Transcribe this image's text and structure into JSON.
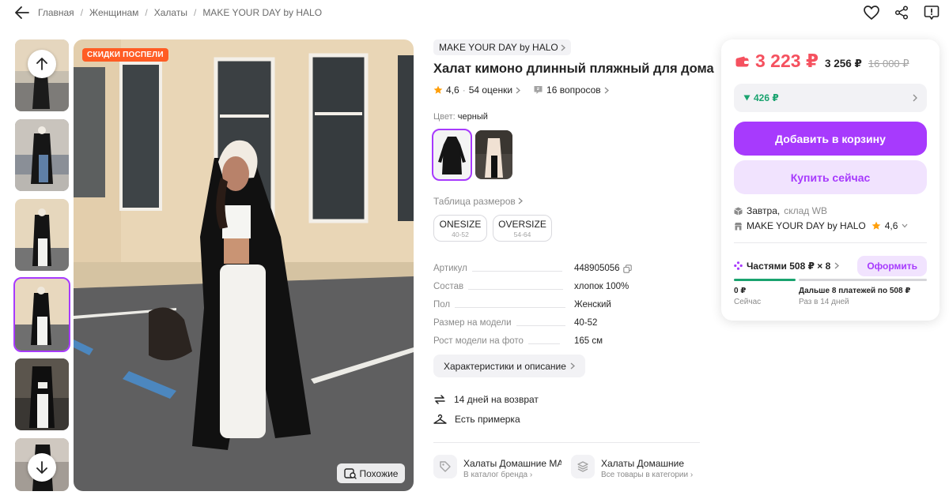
{
  "header": {
    "breadcrumbs": [
      "Главная",
      "Женщинам",
      "Халаты",
      "MAKE YOUR DAY by HALO"
    ],
    "icons": [
      "back-arrow-icon",
      "heart-icon",
      "share-icon",
      "feedback-icon"
    ]
  },
  "gallery": {
    "badge": "СКИДКИ ПОСПЕЛИ",
    "similar_label": "Похожие",
    "active_thumb_index": 3
  },
  "product": {
    "brand": "MAKE YOUR DAY by HALO",
    "title": "Халат кимоно длинный пляжный для дома",
    "rating": "4,6",
    "reviews": "54 оценки",
    "questions": "16 вопросов",
    "color_label": "Цвет:",
    "color_value": "черный",
    "size_table": "Таблица размеров",
    "sizes": [
      {
        "name": "ONESIZE",
        "range": "40-52"
      },
      {
        "name": "OVERSIZE",
        "range": "54-64"
      }
    ],
    "specs": [
      {
        "key": "Артикул",
        "value": "448905056"
      },
      {
        "key": "Состав",
        "value": "хлопок 100%"
      },
      {
        "key": "Пол",
        "value": "Женский"
      },
      {
        "key": "Размер на модели",
        "value": "40-52"
      },
      {
        "key": "Рост модели на фото",
        "value": "165 см"
      }
    ],
    "characteristics_button": "Характеристики и описание",
    "features": [
      "14 дней на возврат",
      "Есть примерка"
    ],
    "categories": [
      {
        "title": "Халаты Домашние MAKE YOUR DAY by HALO",
        "subtitle": "В каталог бренда"
      },
      {
        "title": "Халаты Домашние",
        "subtitle": "Все товары в категории"
      }
    ]
  },
  "price_card": {
    "price": "3 223 ₽",
    "price_no_wallet": "3 256 ₽",
    "price_old": "16 000 ₽",
    "cashback": "426 ₽",
    "add_to_cart": "Добавить в корзину",
    "buy_now": "Купить сейчас",
    "delivery_prefix": "Завтра,",
    "delivery_warehouse": "склад WB",
    "seller": "MAKE YOUR DAY by HALO",
    "seller_rating": "4,6",
    "installment": "Частями 508 ₽ × 8",
    "installment_button": "Оформить",
    "pay_now_value": "0 ₽",
    "pay_now_label": "Сейчас",
    "pay_later_value": "Дальше 8 платежей по 508 ₽",
    "pay_later_label": "Раз в 14 дней",
    "installment_progress": 0.375
  },
  "colors": {
    "accent": "#a73afd",
    "price": "#f5515f",
    "cashback": "#1aa36f",
    "badge": "#ff5c24"
  }
}
